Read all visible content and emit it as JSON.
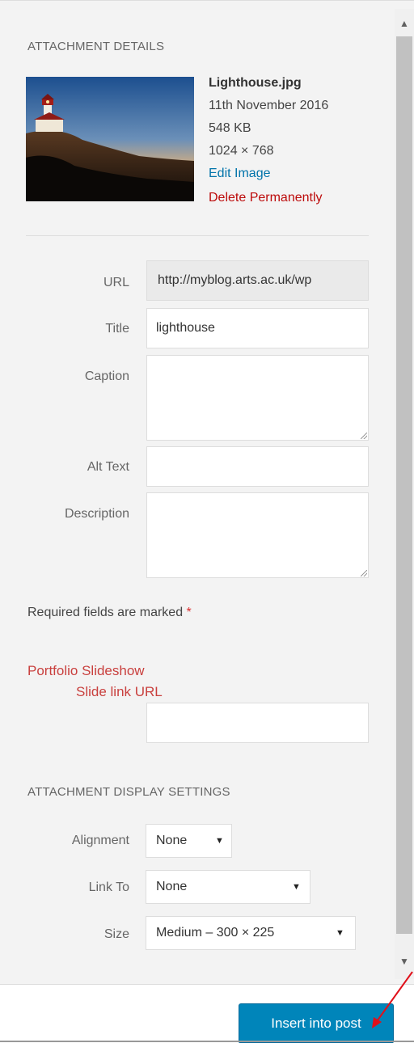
{
  "attachment_details": {
    "heading": "ATTACHMENT DETAILS",
    "filename": "Lighthouse.jpg",
    "date": "11th November 2016",
    "file_size": "548 KB",
    "dimensions": "1024 × 768",
    "edit_link": "Edit Image",
    "delete_link": "Delete Permanently"
  },
  "fields": {
    "url_label": "URL",
    "url_value": "http://myblog.arts.ac.uk/wp",
    "title_label": "Title",
    "title_value": "lighthouse",
    "caption_label": "Caption",
    "caption_value": "",
    "alt_label": "Alt Text",
    "alt_value": "",
    "description_label": "Description",
    "description_value": ""
  },
  "required_note": {
    "text": "Required fields are marked ",
    "star": "*"
  },
  "portfolio": {
    "label_line1": "Portfolio Slideshow",
    "label_line2": "Slide link URL",
    "value": ""
  },
  "display_settings": {
    "heading": "ATTACHMENT DISPLAY SETTINGS",
    "alignment_label": "Alignment",
    "alignment_value": "None",
    "link_to_label": "Link To",
    "link_to_value": "None",
    "size_label": "Size",
    "size_value": "Medium – 300 × 225"
  },
  "footer": {
    "insert_button": "Insert into post"
  },
  "colors": {
    "accent": "#0085ba",
    "link": "#0073aa",
    "danger": "#bc0b0b",
    "annotation_arrow": "#e0101a"
  },
  "icons": {
    "scroll_up": "triangle-up-icon",
    "scroll_down": "triangle-down-icon",
    "select_caret": "triangle-down-icon"
  }
}
